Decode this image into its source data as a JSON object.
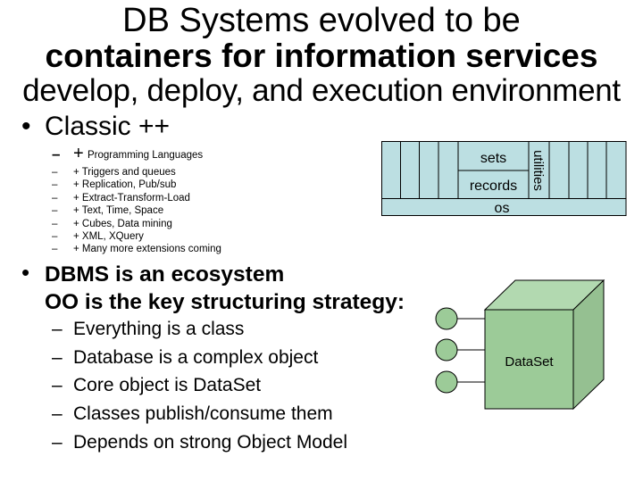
{
  "slide": {
    "title_line1": "DB Systems evolved to be",
    "title_line2": "containers for information services",
    "title_line3": "develop, deploy, and execution environment"
  },
  "classic": {
    "bullet": "•",
    "label": "Classic ++",
    "first_item": {
      "dash": "–",
      "plus": "+",
      "text": "Programming Languages"
    },
    "items": [
      {
        "dash": "–",
        "text": "+ Triggers and queues"
      },
      {
        "dash": "–",
        "text": "+ Replication, Pub/sub"
      },
      {
        "dash": "–",
        "text": "+ Extract-Transform-Load"
      },
      {
        "dash": "–",
        "text": "+ Text, Time, Space"
      },
      {
        "dash": "–",
        "text": "+ Cubes, Data mining"
      },
      {
        "dash": "–",
        "text": "+ XML, XQuery"
      },
      {
        "dash": "–",
        "text": "+ Many more extensions coming"
      }
    ]
  },
  "ecosystem": {
    "bullet": "•",
    "line1": "DBMS is an ecosystem",
    "line2": "OO is the key structuring strategy:",
    "items": [
      {
        "dash": "–",
        "text": "Everything is a class"
      },
      {
        "dash": "–",
        "text": "Database is a complex object"
      },
      {
        "dash": "–",
        "text": "Core object is DataSet"
      },
      {
        "dash": "–",
        "text": "Classes publish/consume them"
      },
      {
        "dash": "–",
        "text": "Depends on strong Object Model"
      }
    ]
  },
  "layer_diagram": {
    "fill_color": "#bcdfe2",
    "sets_label": "sets",
    "records_label": "records",
    "utilities_label": "utilities",
    "os_label": "os"
  },
  "dataset_diagram": {
    "label": "DataSet",
    "front_color": "#9ccb98",
    "top_color": "#b2d9b0",
    "side_color": "#95c091",
    "interface_count": 3
  }
}
